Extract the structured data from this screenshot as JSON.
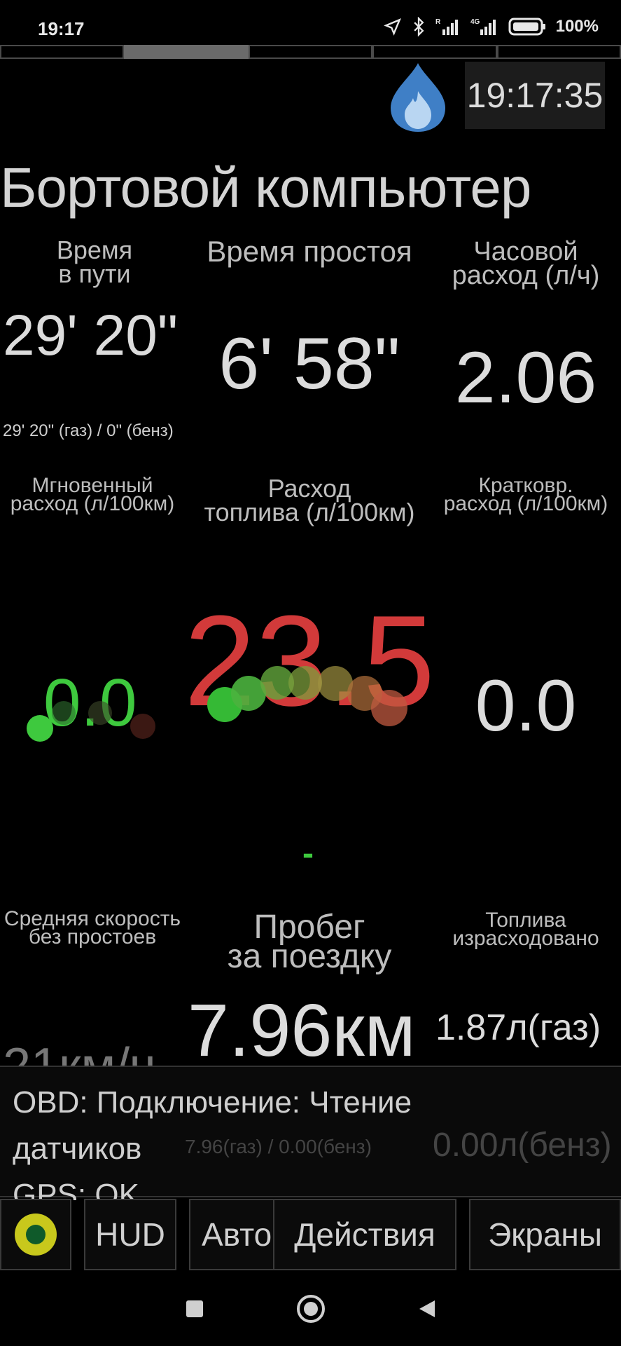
{
  "status_bar": {
    "time": "19:17",
    "battery": "100%",
    "icons": [
      "location-icon",
      "bluetooth-icon",
      "signal-r-icon",
      "signal-4g-icon",
      "battery-icon"
    ]
  },
  "clock": "19:17:35",
  "title": "Бортовой компьютер",
  "metrics": {
    "travel_time": {
      "label1": "Время",
      "label2": "в пути",
      "value": "29' 20\"",
      "sub": "29' 20\" (газ) / 0\" (бенз)"
    },
    "idle_time": {
      "label": "Время простоя",
      "value": "6' 58\""
    },
    "hourly": {
      "label1": "Часовой",
      "label2": "расход (л/ч)",
      "value": "2.06"
    },
    "instant": {
      "label1": "Мгновенный",
      "label2": "расход (л/100км)",
      "value": "0.0"
    },
    "fuel": {
      "label1": "Расход",
      "label2": "топлива (л/100км)",
      "value": "23.5"
    },
    "short": {
      "label1": "Кратковр.",
      "label2": "расход (л/100км)",
      "value": "0.0"
    },
    "dash": "-",
    "avg_speed": {
      "label1": "Средняя скорость",
      "label2": "без простоев",
      "value": "21км/ч"
    },
    "distance": {
      "label1": "Пробег",
      "label2": "за поездку",
      "value": "7.96км",
      "sub": "7.96(газ) / 0.00(бенз)"
    },
    "fuel_used": {
      "label1": "Топлива",
      "label2": "израсходовано",
      "value": "1.87л(газ)",
      "value2": "0.00л(бенз)"
    }
  },
  "obd": {
    "line1": "OBD: Подключение: Чтение",
    "line2": "датчиков",
    "line3": "GPS: OK"
  },
  "buttons": {
    "hud": "HUD",
    "auto": "Авто",
    "actions": "Действия",
    "screens": "Экраны"
  },
  "colors": {
    "accent_red": "#d23a3a",
    "accent_green": "#3ec93e"
  }
}
